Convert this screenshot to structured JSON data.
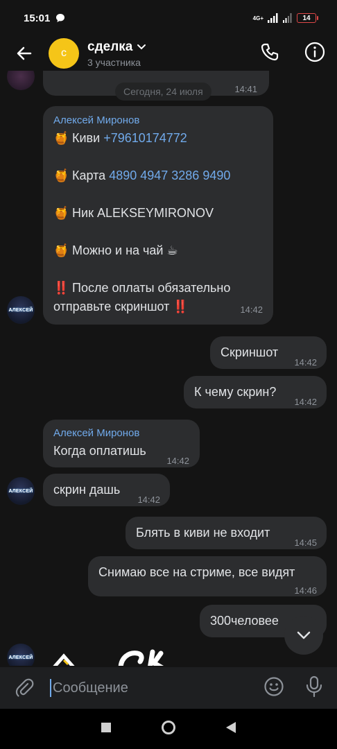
{
  "status_bar": {
    "time": "15:01",
    "network": "4G+",
    "battery": "14"
  },
  "header": {
    "back_icon": "arrow-left-icon",
    "avatar_letter": "с",
    "title": "сделка",
    "subtitle": "3 участника",
    "call_icon": "phone-icon",
    "info_icon": "info-icon",
    "colors": {
      "avatar": "#f5c518"
    }
  },
  "chat": {
    "prev_time": "14:41",
    "date_divider": "Сегодня, 24 июля",
    "pinned_message": {
      "sender": "Алексей Миронов",
      "lines": [
        {
          "emoji": "🍯",
          "text": "Киви ",
          "link": "+79610174772"
        },
        {
          "emoji": "🍯",
          "text": "Карта ",
          "link": "4890 4947 3286 9490"
        },
        {
          "emoji": "🍯",
          "text": "Ник ALEKSEYMIRONOV"
        },
        {
          "emoji": "🍯",
          "text": "Можно и на чай ☕"
        },
        {
          "emoji": "‼️",
          "text": "После оплаты обязательно"
        },
        {
          "text": "отправьте скриншот ‼️"
        }
      ],
      "time": "14:42"
    },
    "messages": [
      {
        "text": "Скриншот",
        "time": "14:42",
        "out": true
      },
      {
        "text": "К чему скрин?",
        "time": "14:42",
        "out": true
      },
      {
        "sender": "Алексей Миронов",
        "text": "Когда оплатишь",
        "time": "14:42",
        "out": false
      },
      {
        "text": "скрин дашь",
        "time": "14:42",
        "out": false
      },
      {
        "text": "Блять в киви не входит",
        "time": "14:45",
        "out": true
      },
      {
        "text": "Снимаю все на стриме, все видят",
        "time": "14:46",
        "out": true
      },
      {
        "text": "300человее",
        "time": "",
        "out": true
      }
    ],
    "avatar_text": "АЛЕКСЕЙ",
    "scroll_down_icon": "chevron-down-icon"
  },
  "composer": {
    "placeholder": "Сообщение",
    "attach_icon": "paperclip-icon",
    "emoji_icon": "smile-icon",
    "mic_icon": "microphone-icon"
  },
  "nav": {
    "recent_icon": "square-icon",
    "home_icon": "circle-icon",
    "back_icon": "triangle-back-icon"
  }
}
